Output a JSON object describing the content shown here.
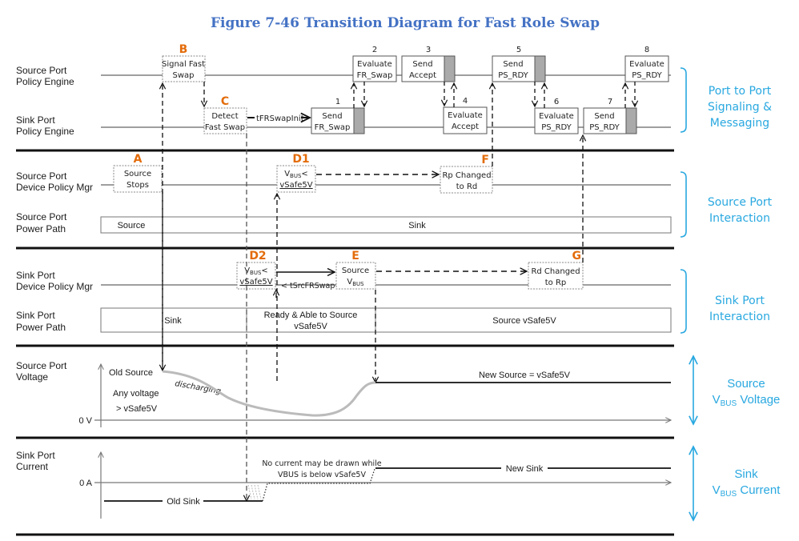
{
  "title": "Figure 7-46 Transition Diagram for Fast Role Swap",
  "colors": {
    "title": "#4472C4",
    "event_letter": "#E36C0A",
    "group_label": "#29A8E0",
    "message_fill": "#AAAAAA",
    "voltage_curve": "#BBBBBB"
  },
  "row_labels": {
    "src_pe": [
      "Source Port",
      "Policy Engine"
    ],
    "snk_pe": [
      "Sink Port",
      "Policy Engine"
    ],
    "src_dpm": [
      "Source Port",
      "Device Policy Mgr"
    ],
    "src_pp": [
      "Source Port",
      "Power Path"
    ],
    "snk_dpm": [
      "Sink Port",
      "Device Policy Mgr"
    ],
    "snk_pp": [
      "Sink Port",
      "Power Path"
    ],
    "src_v": [
      "Source Port",
      "Voltage"
    ],
    "snk_i": [
      "Sink Port",
      "Current"
    ]
  },
  "group_labels": {
    "signaling": [
      "Port to Port",
      "Signaling &",
      "Messaging"
    ],
    "source_interaction": [
      "Source Port",
      "Interaction"
    ],
    "sink_interaction": [
      "Sink Port",
      "Interaction"
    ],
    "source_vbus": [
      "Source",
      "V",
      "BUS",
      " Voltage"
    ],
    "sink_vbus": [
      "Sink",
      "V",
      "BUS",
      " Current"
    ]
  },
  "events": {
    "A": {
      "letter": "A",
      "lines": [
        "Source",
        "Stops"
      ]
    },
    "B": {
      "letter": "B",
      "lines": [
        "Signal Fast",
        "Swap"
      ]
    },
    "C": {
      "letter": "C",
      "lines": [
        "Detect",
        "Fast Swap"
      ]
    },
    "D1": {
      "letter": "D1",
      "line1_main": "V",
      "line1_sub": "BUS",
      "line1_tail": "<",
      "line2": "vSafe5V"
    },
    "D2": {
      "letter": "D2",
      "line1_main": "V",
      "line1_sub": "BUS",
      "line1_tail": "<",
      "line2": "vSafe5V"
    },
    "E": {
      "letter": "E",
      "line1": "Source",
      "line2_main": "V",
      "line2_sub": "BUS"
    },
    "F": {
      "letter": "F",
      "lines": [
        "Rp Changed",
        "to Rd"
      ]
    },
    "G": {
      "letter": "G",
      "lines": [
        "Rd Changed",
        "to Rp"
      ]
    }
  },
  "messages": [
    {
      "num": "1",
      "lines": [
        "Send",
        "FR_Swap"
      ]
    },
    {
      "num": "2",
      "lines": [
        "Evaluate",
        "FR_Swap"
      ]
    },
    {
      "num": "3",
      "lines": [
        "Send",
        "Accept"
      ]
    },
    {
      "num": "4",
      "lines": [
        "Evaluate",
        "Accept"
      ]
    },
    {
      "num": "5",
      "lines": [
        "Send",
        "PS_RDY"
      ]
    },
    {
      "num": "6",
      "lines": [
        "Evaluate",
        "PS_RDY"
      ]
    },
    {
      "num": "7",
      "lines": [
        "Send",
        "PS_RDY"
      ]
    },
    {
      "num": "8",
      "lines": [
        "Evaluate",
        "PS_RDY"
      ]
    }
  ],
  "timers": {
    "tFRSwapInit": "tFRSwapInit",
    "tSrcFRSwap": "< tSrcFRSwap"
  },
  "power_paths": {
    "source": [
      "Source",
      "Sink"
    ],
    "sink": {
      "sink": "Sink",
      "ready": [
        "Ready & Able to Source",
        "vSafe5V"
      ],
      "source": "Source vSafe5V"
    }
  },
  "voltage": {
    "old_source": "Old Source",
    "any_voltage": [
      "Any voltage",
      "> vSafe5V"
    ],
    "discharging": "discharging",
    "new_source": "New Source = vSafe5V",
    "zero": "0 V"
  },
  "current": {
    "zero": "0 A",
    "old_sink": "Old Sink",
    "new_sink": "New Sink",
    "note": [
      "No current may be drawn while",
      "VBUS is below vSafe5V"
    ]
  }
}
